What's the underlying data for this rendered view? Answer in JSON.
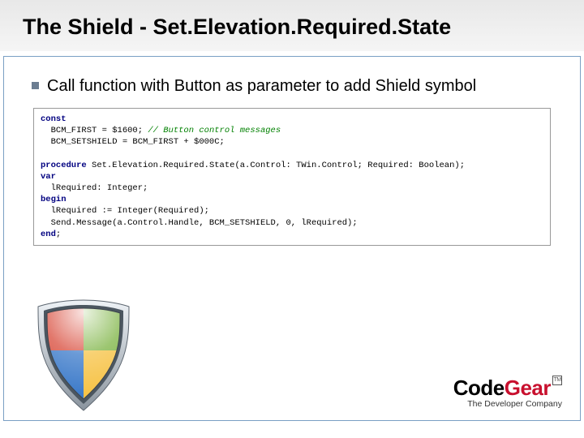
{
  "header": {
    "title": "The Shield - Set.Elevation.Required.State"
  },
  "bullet": {
    "text": "Call function with Button as parameter to add Shield symbol"
  },
  "code": {
    "l1_kw": "const",
    "l2": "  BCM_FIRST = $1600; ",
    "l2_cm": "// Button control messages",
    "l3": "  BCM_SETSHIELD = BCM_FIRST + $000C;",
    "l4": "",
    "l5_kw": "procedure",
    "l5": " Set.Elevation.Required.State(a.Control: TWin.Control; Required: Boolean);",
    "l6_kw": "var",
    "l7": "  lRequired: Integer;",
    "l8_kw": "begin",
    "l9": "  lRequired := Integer(Required);",
    "l10": "  Send.Message(a.Control.Handle, BCM_SETSHIELD, 0, lRequired);",
    "l11_kw": "end",
    "l11": ";"
  },
  "logo": {
    "code": "Code",
    "gear": "Gear",
    "tm": "TM",
    "tagline": "The Developer Company"
  },
  "shield": {
    "colors": {
      "red": "#d84a3a",
      "green": "#7cb342",
      "blue": "#3a79c9",
      "yellow": "#f6c244",
      "rim_light": "#d6dde4",
      "rim_dark": "#8a949e"
    }
  }
}
